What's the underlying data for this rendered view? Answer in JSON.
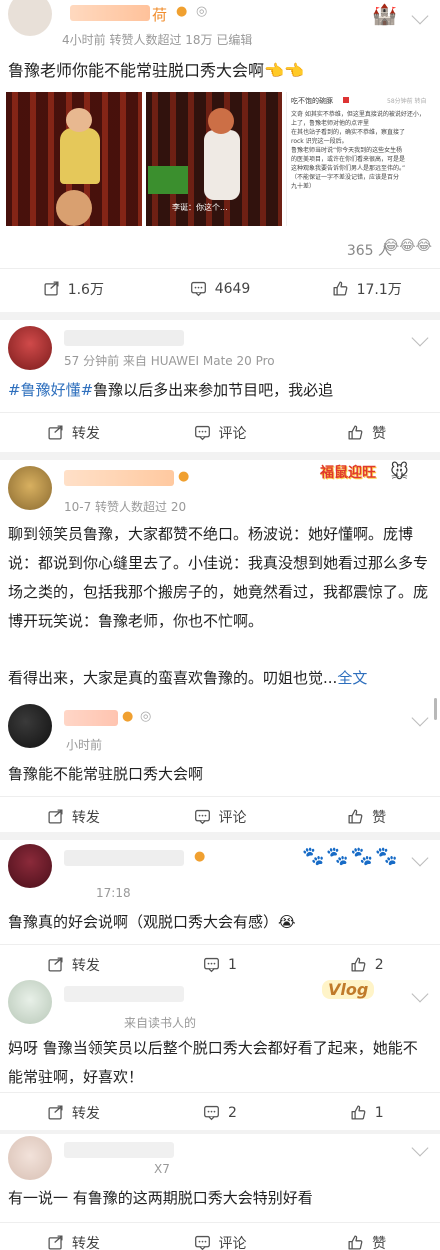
{
  "post": {
    "author_name_suffix": "荷",
    "meta": "4小时前  转赞人数超过 18万    已编辑",
    "text": "鲁豫老师你能不能常驻脱口秀大会啊",
    "emoji": "👈👈",
    "image2_caption": "李诞：你这个...",
    "image3": {
      "title": "吃不饱的碗豚",
      "sub": "58分钟前 转自",
      "lines": [
        "文奇 如其实不恭维，但这里真接说的被说好还小，",
        "上了，鲁豫老师对他的点评里",
        "",
        "在其也站子看到的，确实不恭维，察直接了",
        "rock 识完这一段后。",
        "鲁豫老师当时说“你今天我到的这些女生杨",
        "的医美项目，或许在你们看来很高，可是是",
        "这种观象我要告诉你们男人是那远至伟的。”",
        "（不能保证一字不差没记错，应该是百分",
        "九十差）"
      ]
    },
    "like_summary": "365 人",
    "like_emojis": "😂😂😂",
    "stats": {
      "repost": "1.6万",
      "comment": "4649",
      "like": "17.1万"
    }
  },
  "comments": [
    {
      "meta": "57 分钟前  来自 HUAWEI Mate 20 Pro",
      "hashtag": "#鲁豫好懂#",
      "text": "鲁豫以后多出来参加节目吧，我必追",
      "actions": {
        "repost": "转发",
        "comment": "评论",
        "like": "赞"
      }
    },
    {
      "meta": "10-7  转赞人数超过 20",
      "badge": "福鼠迎旺",
      "text": "聊到领笑员鲁豫，大家都赞不绝口。杨波说：她好懂啊。庞博说：都说到你心缝里去了。小佳说：我真没想到她看过那么多专场之类的，包括我那个搬房子的，她竟然看过，我都震惊了。庞博开玩笑说：鲁豫老师，你也不忙啊。",
      "text2": "看得出来，大家是真的蛮喜欢鲁豫的。叨姐也觉...",
      "more": "全文"
    },
    {
      "meta": "小时前",
      "text": "鲁豫能不能常驻脱口秀大会啊",
      "actions": {
        "repost": "转发",
        "comment": "评论",
        "like": "赞"
      }
    },
    {
      "meta": "17:18",
      "text": "鲁豫真的好会说啊（观脱口秀大会有感）",
      "emoji": "😭",
      "actions": {
        "repost": "转发",
        "comment": "1",
        "like": "2"
      }
    },
    {
      "meta": "来自读书人的",
      "badge": "Vlog",
      "text": "妈呀 鲁豫当领笑员以后整个脱口秀大会都好看了起来，她能不能常驻啊，好喜欢！",
      "actions": {
        "repost": "转发",
        "comment": "2",
        "like": "1"
      }
    },
    {
      "meta": "X7",
      "text": "有一说一 有鲁豫的这两期脱口秀大会特别好看",
      "actions": {
        "repost": "转发",
        "comment": "评论",
        "like": "赞"
      }
    }
  ],
  "colors": {
    "link": "#2e6fbd",
    "orange": "#f08c2b",
    "text": "#222222",
    "meta": "#999999"
  }
}
